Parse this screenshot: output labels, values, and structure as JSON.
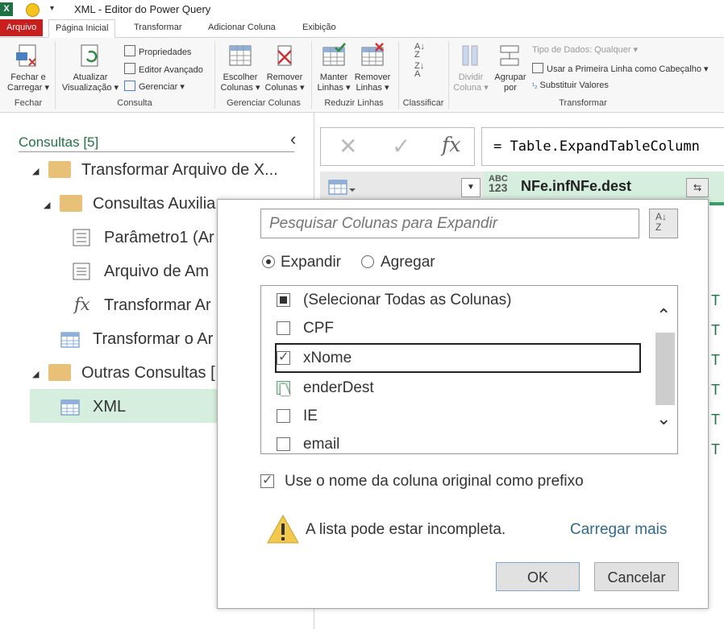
{
  "window": {
    "title": "XML - Editor do Power Query"
  },
  "tabs": [
    "Arquivo",
    "Página Inicial",
    "Transformar",
    "Adicionar Coluna",
    "Exibição"
  ],
  "ribbon": {
    "fechar": {
      "label1": "Fechar e",
      "label2": "Carregar",
      "group": "Fechar"
    },
    "atualizar": {
      "label1": "Atualizar",
      "label2": "Visualização"
    },
    "propriedades": "Propriedades",
    "editor_avancado": "Editor Avançado",
    "gerenciar": "Gerenciar",
    "consulta_group": "Consulta",
    "escolher": {
      "label1": "Escolher",
      "label2": "Colunas"
    },
    "remover_colunas": {
      "label1": "Remover",
      "label2": "Colunas"
    },
    "gerenciar_colunas_group": "Gerenciar Colunas",
    "manter": {
      "label1": "Manter",
      "label2": "Linhas"
    },
    "remover_linhas": {
      "label1": "Remover",
      "label2": "Linhas"
    },
    "reduzir_group": "Reduzir Linhas",
    "classificar_group": "Classificar",
    "dividir": {
      "label1": "Dividir",
      "label2": "Coluna"
    },
    "agrupar": {
      "label1": "Agrupar",
      "label2": "por"
    },
    "tipo_dados": "Tipo de Dados: Qualquer",
    "primeira_linha": "Usar a Primeira Linha como Cabeçalho",
    "substituir": "Substituir Valores",
    "transformar_group": "Transformar"
  },
  "queries": {
    "header": "Consultas [5]",
    "items": [
      {
        "label": "Transformar Arquivo de X..."
      },
      {
        "label": "Consultas Auxilia"
      },
      {
        "label": "Parâmetro1 (Ar"
      },
      {
        "label": "Arquivo de Am"
      },
      {
        "label": "Transformar Ar"
      },
      {
        "label": "Transformar o Ar"
      },
      {
        "label": "Outras Consultas ["
      },
      {
        "label": "XML"
      }
    ]
  },
  "formula": "= Table.ExpandTableColumn",
  "grid": {
    "column_name": "NFe.infNFe.dest",
    "type_top": "ABC",
    "type_bottom": "123",
    "row_marker": "T"
  },
  "dialog": {
    "search_placeholder": "Pesquisar Colunas para Expandir",
    "expand_label": "Expandir",
    "aggregate_label": "Agregar",
    "columns": [
      {
        "label": "(Selecionar Todas as Colunas)",
        "state": "partial"
      },
      {
        "label": "CPF",
        "state": "unchecked"
      },
      {
        "label": "xNome",
        "state": "checked"
      },
      {
        "label": "enderDest",
        "state": "hover"
      },
      {
        "label": "IE",
        "state": "unchecked"
      },
      {
        "label": "email",
        "state": "unchecked"
      }
    ],
    "prefix_label": "Use o nome da coluna original como prefixo",
    "warning": "A lista pode estar incompleta.",
    "load_more": "Carregar mais",
    "ok": "OK",
    "cancel": "Cancelar"
  },
  "colors": {
    "accent": "#217346",
    "selection": "#d5eede",
    "file_tab": "#c81e1e"
  }
}
